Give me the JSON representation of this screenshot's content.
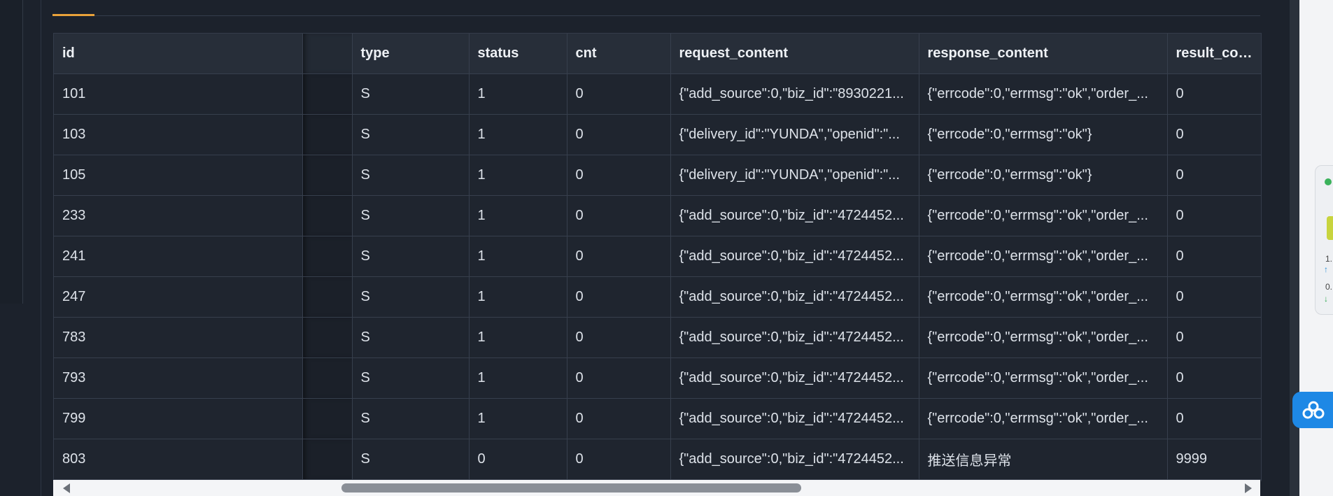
{
  "table": {
    "columns": [
      "id",
      "",
      "type",
      "status",
      "cnt",
      "request_content",
      "response_content",
      "result_code"
    ],
    "rows": [
      [
        "101",
        "",
        "S",
        "1",
        "0",
        "{\"add_source\":0,\"biz_id\":\"8930221...",
        "{\"errcode\":0,\"errmsg\":\"ok\",\"order_...",
        "0"
      ],
      [
        "103",
        "",
        "S",
        "1",
        "0",
        "{\"delivery_id\":\"YUNDA\",\"openid\":\"...",
        "{\"errcode\":0,\"errmsg\":\"ok\"}",
        "0"
      ],
      [
        "105",
        "",
        "S",
        "1",
        "0",
        "{\"delivery_id\":\"YUNDA\",\"openid\":\"...",
        "{\"errcode\":0,\"errmsg\":\"ok\"}",
        "0"
      ],
      [
        "233",
        "",
        "S",
        "1",
        "0",
        "{\"add_source\":0,\"biz_id\":\"4724452...",
        "{\"errcode\":0,\"errmsg\":\"ok\",\"order_...",
        "0"
      ],
      [
        "241",
        "",
        "S",
        "1",
        "0",
        "{\"add_source\":0,\"biz_id\":\"4724452...",
        "{\"errcode\":0,\"errmsg\":\"ok\",\"order_...",
        "0"
      ],
      [
        "247",
        "",
        "S",
        "1",
        "0",
        "{\"add_source\":0,\"biz_id\":\"4724452...",
        "{\"errcode\":0,\"errmsg\":\"ok\",\"order_...",
        "0"
      ],
      [
        "783",
        "",
        "S",
        "1",
        "0",
        "{\"add_source\":0,\"biz_id\":\"4724452...",
        "{\"errcode\":0,\"errmsg\":\"ok\",\"order_...",
        "0"
      ],
      [
        "793",
        "",
        "S",
        "1",
        "0",
        "{\"add_source\":0,\"biz_id\":\"4724452...",
        "{\"errcode\":0,\"errmsg\":\"ok\",\"order_...",
        "0"
      ],
      [
        "799",
        "",
        "S",
        "1",
        "0",
        "{\"add_source\":0,\"biz_id\":\"4724452...",
        "{\"errcode\":0,\"errmsg\":\"ok\",\"order_...",
        "0"
      ],
      [
        "803",
        "",
        "S",
        "0",
        "0",
        "{\"add_source\":0,\"biz_id\":\"4724452...",
        "推送信息异常",
        "9999"
      ]
    ]
  },
  "float_widget": {
    "stat_1": "1.",
    "stat_2": "0."
  },
  "colors": {
    "accent": "#e8a23a",
    "background": "#1c222c",
    "header_bg": "#272e39",
    "cloud_blue": "#1e88e5"
  },
  "icons": {
    "cloud_button": "cloud-icon",
    "scroll_left": "scroll-left-arrow-icon",
    "scroll_right": "scroll-right-arrow-icon"
  }
}
